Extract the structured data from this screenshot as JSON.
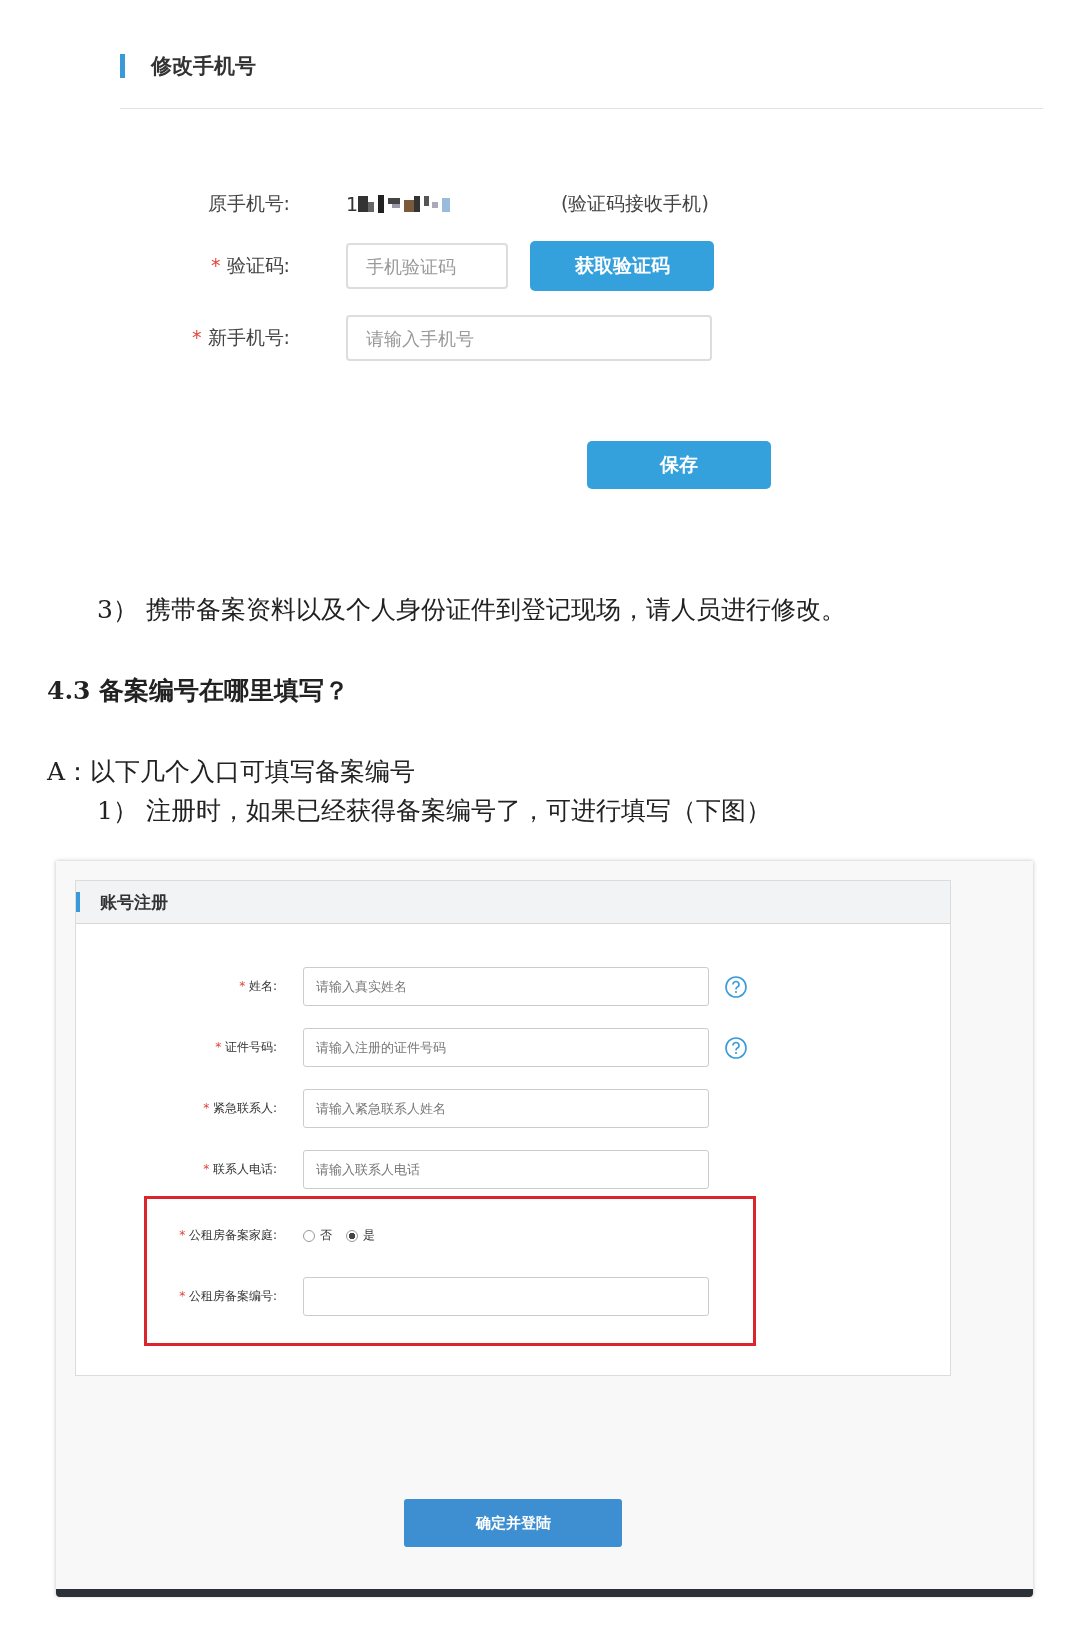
{
  "phone_form": {
    "title": "修改手机号",
    "original_phone": {
      "label": "原手机号:",
      "value": "1",
      "note": "(验证码接收手机)"
    },
    "code": {
      "required_mark": "*",
      "label": "验证码:",
      "placeholder": "手机验证码",
      "button": "获取验证码"
    },
    "new_phone": {
      "required_mark": "*",
      "label": "新手机号:",
      "placeholder": "请输入手机号"
    },
    "save_button": "保存"
  },
  "step_3": "3） 携带备案资料以及个人身份证件到登记现场，请人员进行修改。",
  "section_heading": "4.3 备案编号在哪里填写？",
  "answer_intro": "A：以下几个入口可填写备案编号",
  "step_1": "1） 注册时，如果已经获得备案编号了，可进行填写（下图）",
  "register_form": {
    "title": "账号注册",
    "fields": [
      {
        "kind": "help_input",
        "required_mark": "*",
        "label": "姓名:",
        "placeholder": "请输入真实姓名"
      },
      {
        "kind": "help_input",
        "required_mark": "*",
        "label": "证件号码:",
        "placeholder": "请输入注册的证件号码"
      },
      {
        "kind": "input",
        "required_mark": "*",
        "label": "紧急联系人:",
        "placeholder": "请输入紧急联系人姓名"
      },
      {
        "kind": "input",
        "required_mark": "*",
        "label": "联系人电话:",
        "placeholder": "请输入联系人电话"
      }
    ],
    "highlight_box": {
      "fields": [
        {
          "kind": "radio",
          "required_mark": "*",
          "label": "公租房备案家庭:",
          "options": [
            {
              "label": "否",
              "selected": false
            },
            {
              "label": "是",
              "selected": true
            }
          ]
        },
        {
          "kind": "input",
          "required_mark": "*",
          "label": "公租房备案编号:"
        }
      ]
    },
    "submit_button": "确定并登陆"
  }
}
